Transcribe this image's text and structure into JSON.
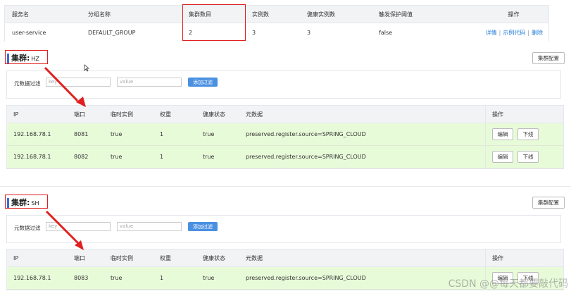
{
  "service_table": {
    "headers": [
      "服务名",
      "分组名称",
      "集群数目",
      "实例数",
      "健康实例数",
      "触发保护阈值",
      "操作"
    ],
    "row": {
      "service_name": "user-service",
      "group": "DEFAULT_GROUP",
      "cluster_count": "2",
      "instance_count": "3",
      "healthy_count": "3",
      "protect_threshold": "false",
      "ops": [
        "详情",
        "示例代码",
        "删除"
      ]
    }
  },
  "clusters": [
    {
      "label": "集群:",
      "name": "HZ",
      "config_button": "集群配置",
      "filter": {
        "label": "元数据过滤",
        "key_placeholder": "key",
        "value_placeholder": "value",
        "add_button": "添加过滤"
      },
      "headers": [
        "IP",
        "端口",
        "临时实例",
        "权重",
        "健康状态",
        "元数据",
        "操作"
      ],
      "rows": [
        {
          "ip": "192.168.78.1",
          "port": "8081",
          "ephemeral": "true",
          "weight": "1",
          "healthy": "true",
          "metadata": "preserved.register.source=SPRING_CLOUD",
          "edit": "编辑",
          "offline": "下线"
        },
        {
          "ip": "192.168.78.1",
          "port": "8082",
          "ephemeral": "true",
          "weight": "1",
          "healthy": "true",
          "metadata": "preserved.register.source=SPRING_CLOUD",
          "edit": "编辑",
          "offline": "下线"
        }
      ]
    },
    {
      "label": "集群:",
      "name": "SH",
      "config_button": "集群配置",
      "filter": {
        "label": "元数据过滤",
        "key_placeholder": "key",
        "value_placeholder": "value",
        "add_button": "添加过滤"
      },
      "headers": [
        "IP",
        "端口",
        "临时实例",
        "权重",
        "健康状态",
        "元数据",
        "操作"
      ],
      "rows": [
        {
          "ip": "192.168.78.1",
          "port": "8083",
          "ephemeral": "true",
          "weight": "1",
          "healthy": "true",
          "metadata": "preserved.register.source=SPRING_CLOUD",
          "edit": "编辑",
          "offline": "下线"
        }
      ]
    }
  ],
  "annotation_color": "#e02020",
  "watermark": "CSDN @@每天都要敲代码"
}
